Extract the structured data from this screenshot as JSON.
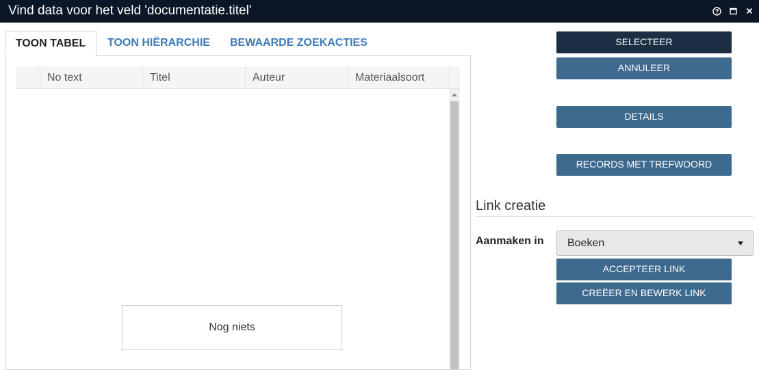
{
  "window": {
    "title": "Vind data voor het veld 'documentatie.titel'",
    "controls": {
      "help_icon": "question-circle-icon",
      "maximize_icon": "maximize-icon",
      "close_icon": "close-icon"
    }
  },
  "tabs": [
    {
      "label": "TOON TABEL",
      "active": true
    },
    {
      "label": "TOON HIËRARCHIE",
      "active": false
    },
    {
      "label": "BEWAARDE ZOEKACTIES",
      "active": false
    }
  ],
  "grid": {
    "columns": [
      "",
      "No text",
      "Titel",
      "Auteur",
      "Materiaalsoort"
    ],
    "rows": [],
    "empty_message": "Nog niets"
  },
  "actions": {
    "select": "SELECTEER",
    "cancel": "ANNULEER",
    "details": "DETAILS",
    "records_with_keyword": "RECORDS MET TREFWOORD"
  },
  "link_creation": {
    "heading": "Link creatie",
    "create_in_label": "Aanmaken in",
    "create_in_value": "Boeken",
    "accept_link": "ACCEPTEER LINK",
    "create_and_edit_link": "CREËER EN BEWERK LINK"
  },
  "colors": {
    "titlebar": "#0b1626",
    "primary_button": "#3e6a8f",
    "default_button": "#1b2e42",
    "tab_link": "#3d7ab8"
  }
}
